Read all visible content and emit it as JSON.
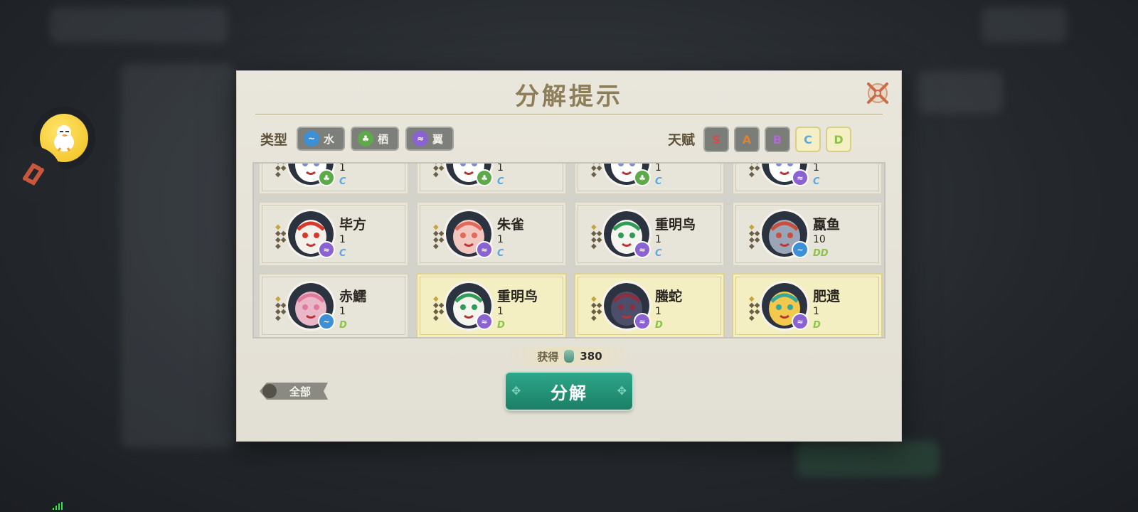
{
  "dialog": {
    "title": "分解提示",
    "type_label": "类型",
    "talent_label": "天赋",
    "types": [
      {
        "label": "水",
        "color": "#3d8fd6",
        "icon": "water-icon"
      },
      {
        "label": "栖",
        "color": "#5ea94a",
        "icon": "habitat-icon"
      },
      {
        "label": "翼",
        "color": "#8a62d1",
        "icon": "wing-icon"
      }
    ],
    "grades": [
      {
        "label": "S",
        "color": "#d24b4b",
        "active": false
      },
      {
        "label": "A",
        "color": "#e0812f",
        "active": false
      },
      {
        "label": "B",
        "color": "#b06ad6",
        "active": false
      },
      {
        "label": "C",
        "color": "#5aa8e6",
        "active": true
      },
      {
        "label": "D",
        "color": "#8bc34a",
        "active": true
      }
    ]
  },
  "cards": [
    {
      "name": "",
      "count": "1",
      "grade": "C",
      "type": "habitat",
      "selected": false
    },
    {
      "name": "",
      "count": "1",
      "grade": "C",
      "type": "habitat",
      "selected": false
    },
    {
      "name": "",
      "count": "1",
      "grade": "C",
      "type": "habitat",
      "selected": false
    },
    {
      "name": "",
      "count": "1",
      "grade": "C",
      "type": "wing",
      "selected": false
    },
    {
      "name": "毕方",
      "count": "1",
      "grade": "C",
      "type": "wing",
      "selected": false
    },
    {
      "name": "朱雀",
      "count": "1",
      "grade": "C",
      "type": "wing",
      "selected": false
    },
    {
      "name": "重明鸟",
      "count": "1",
      "grade": "C",
      "type": "wing",
      "selected": false
    },
    {
      "name": "蠃鱼",
      "count": "10",
      "grade": "DD",
      "type": "water",
      "selected": false
    },
    {
      "name": "赤鱬",
      "count": "1",
      "grade": "D",
      "type": "water",
      "selected": false
    },
    {
      "name": "重明鸟",
      "count": "1",
      "grade": "D",
      "type": "wing",
      "selected": true
    },
    {
      "name": "螣蛇",
      "count": "1",
      "grade": "D",
      "type": "wing",
      "selected": true
    },
    {
      "name": "肥遗",
      "count": "1",
      "grade": "D",
      "type": "wing",
      "selected": true
    }
  ],
  "reward": {
    "label": "获得",
    "value": "380"
  },
  "buttons": {
    "all": "全部",
    "decompose": "分解"
  },
  "colors": {
    "grade_C": "#5aa8e6",
    "grade_D": "#8bc34a",
    "accent_green": "#1f8f73"
  }
}
